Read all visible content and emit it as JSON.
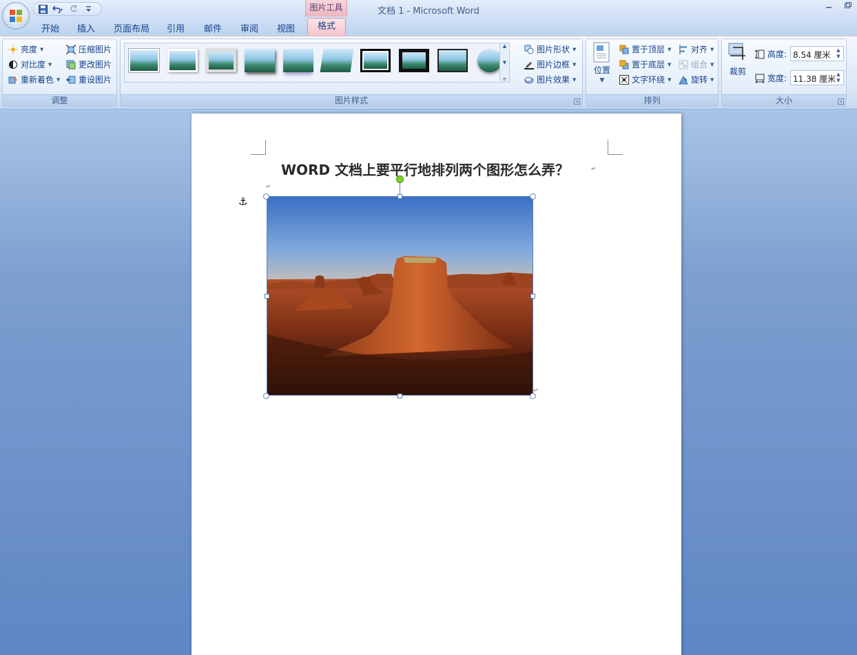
{
  "window": {
    "title": "文档 1 - Microsoft Word",
    "contextual_group": "图片工具"
  },
  "quick_access": {
    "icons": [
      "save-icon",
      "undo-icon",
      "redo-icon",
      "customize-qat-icon"
    ]
  },
  "tabs": [
    "开始",
    "插入",
    "页面布局",
    "引用",
    "邮件",
    "审阅",
    "视图"
  ],
  "active_tab": "格式",
  "ribbon": {
    "adjust": {
      "label": "调整",
      "brightness": "亮度",
      "contrast": "对比度",
      "recolor": "重新着色",
      "compress": "压缩图片",
      "change": "更改图片",
      "reset": "重设图片"
    },
    "picture_styles": {
      "label": "图片样式",
      "shape": "图片形状",
      "border": "图片边框",
      "effects": "图片效果"
    },
    "arrange": {
      "label": "排列",
      "position": "位置",
      "bring_front": "置于顶层",
      "send_back": "置于底层",
      "text_wrap": "文字环绕",
      "align": "对齐",
      "group": "组合",
      "rotate": "旋转"
    },
    "size": {
      "label": "大小",
      "crop": "裁剪",
      "height_label": "高度:",
      "height_value": "8.54 厘米",
      "width_label": "宽度:",
      "width_value": "11.38 厘米"
    }
  },
  "document": {
    "heading": "WORD 文档上要平行地排列两个图形怎么弄？"
  },
  "colors": {
    "ribbon_accent": "#15428b",
    "contextual_tab": "#f3c3cb",
    "selection_handle": "#5a7fb5",
    "rotation_handle": "#7ed321"
  }
}
